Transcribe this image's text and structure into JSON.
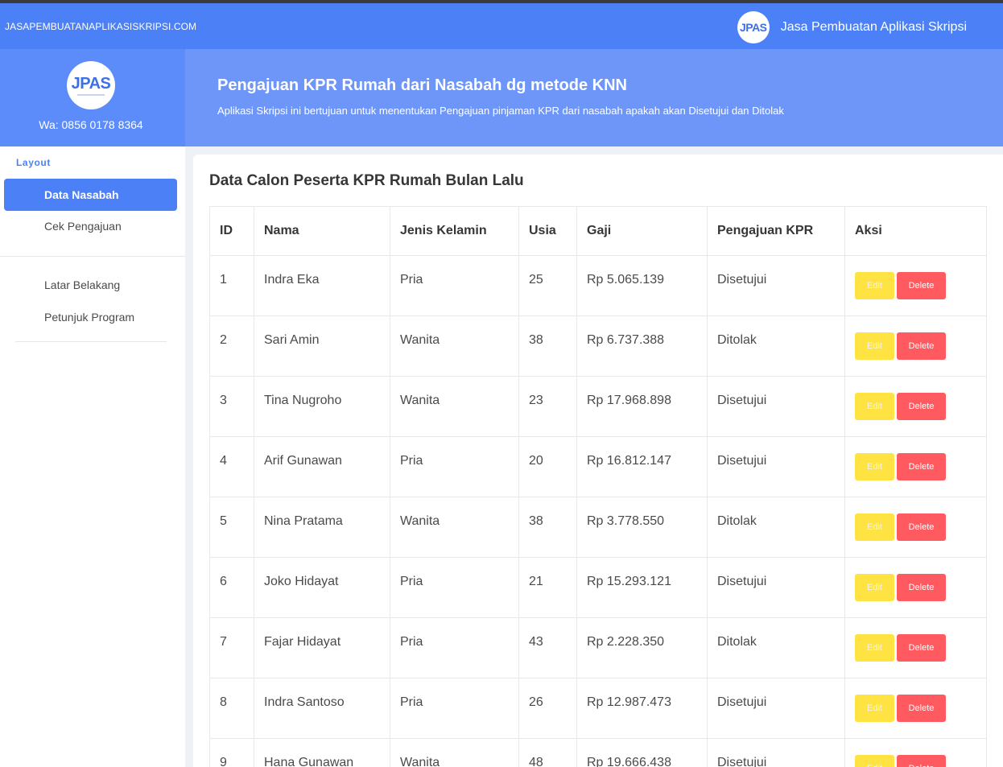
{
  "navbar": {
    "brand": "JASAPEMBUATANAPLIKASISKRIPSI.COM",
    "logo_text": "JPAS",
    "title": "Jasa Pembuatan Aplikasi Skripsi"
  },
  "sidebar_head": {
    "logo_text": "JPAS",
    "wa": "Wa: 0856 0178 8364"
  },
  "hero": {
    "title": "Pengajuan KPR Rumah dari Nasabah dg metode KNN",
    "subtitle": "Aplikasi Skripsi ini bertujuan untuk menentukan Pengajuan pinjaman KPR dari nasabah apakah akan Disetujui dan Ditolak"
  },
  "menu": {
    "label": "Layout",
    "items": [
      {
        "label": "Data Nasabah",
        "active": true
      },
      {
        "label": "Cek Pengajuan",
        "active": false
      },
      {
        "label": "Latar Belakang",
        "active": false
      },
      {
        "label": "Petunjuk Program",
        "active": false
      }
    ]
  },
  "card": {
    "title": "Data Calon Peserta KPR Rumah Bulan Lalu"
  },
  "table": {
    "headers": [
      "ID",
      "Nama",
      "Jenis Kelamin",
      "Usia",
      "Gaji",
      "Pengajuan KPR",
      "Aksi"
    ],
    "edit_label": "Edit",
    "delete_label": "Delete",
    "rows": [
      [
        "1",
        "Indra Eka",
        "Pria",
        "25",
        "Rp 5.065.139",
        "Disetujui"
      ],
      [
        "2",
        "Sari Amin",
        "Wanita",
        "38",
        "Rp 6.737.388",
        "Ditolak"
      ],
      [
        "3",
        "Tina Nugroho",
        "Wanita",
        "23",
        "Rp 17.968.898",
        "Disetujui"
      ],
      [
        "4",
        "Arif Gunawan",
        "Pria",
        "20",
        "Rp 16.812.147",
        "Disetujui"
      ],
      [
        "5",
        "Nina Pratama",
        "Wanita",
        "38",
        "Rp 3.778.550",
        "Ditolak"
      ],
      [
        "6",
        "Joko Hidayat",
        "Pria",
        "21",
        "Rp 15.293.121",
        "Disetujui"
      ],
      [
        "7",
        "Fajar Hidayat",
        "Pria",
        "43",
        "Rp 2.228.350",
        "Ditolak"
      ],
      [
        "8",
        "Indra Santoso",
        "Pria",
        "26",
        "Rp 12.987.473",
        "Disetujui"
      ],
      [
        "9",
        "Hana Gunawan",
        "Wanita",
        "48",
        "Rp 19.666.438",
        "Disetujui"
      ]
    ]
  }
}
